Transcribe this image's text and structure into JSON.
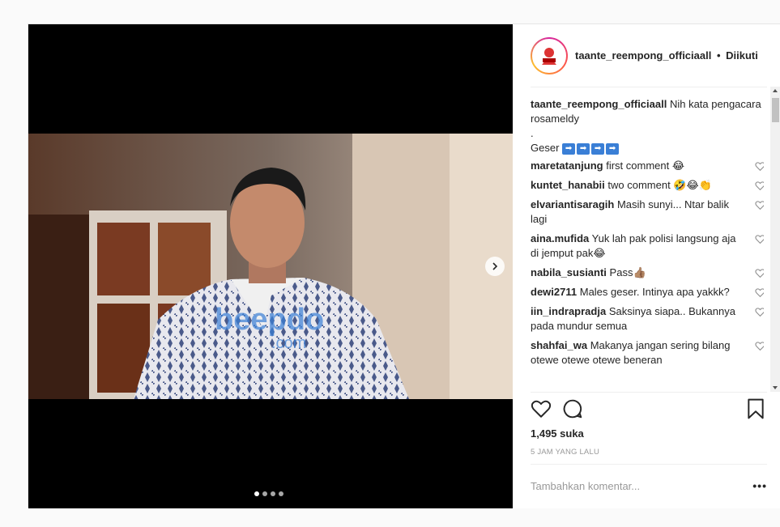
{
  "post": {
    "username": "taante_reempong_officiaall",
    "separator": "•",
    "follow_status": "Diikuti",
    "caption_username": "taante_reempong_officiaall",
    "caption_line1": "Nih kata pengacara rosameldy",
    "caption_line2": ".",
    "caption_line3": "Geser",
    "caption_arrows": [
      "➡",
      "➡",
      "➡",
      "➡"
    ],
    "watermark": "beepdo.com",
    "carousel_count": 4,
    "carousel_active": 0
  },
  "comments": [
    {
      "user": "maretatanjung",
      "text": "first comment 😂"
    },
    {
      "user": "kuntet_hanabii",
      "text": "two comment 🤣😂👏"
    },
    {
      "user": "elvariantisaragih",
      "text": "Masih sunyi... Ntar balik lagi"
    },
    {
      "user": "aina.mufida",
      "text": "Yuk lah pak polisi langsung aja di jemput pak😂"
    },
    {
      "user": "nabila_susianti",
      "text": "Pass👍🏽"
    },
    {
      "user": "dewi2711",
      "text": "Males geser. Intinya apa yakkk?"
    },
    {
      "user": "iin_indrapradja",
      "text": "Saksinya siapa.. Bukannya pada mundur semua"
    },
    {
      "user": "shahfai_wa",
      "text": "Makanya jangan sering bilang otewe otewe otewe beneran"
    }
  ],
  "likes": "1,495 suka",
  "timestamp": "5 JAM YANG LALU",
  "add_comment_placeholder": "Tambahkan komentar...",
  "more_label": "•••",
  "icons": [
    "heart-icon",
    "comment-icon",
    "bookmark-icon",
    "chevron-right-icon"
  ]
}
